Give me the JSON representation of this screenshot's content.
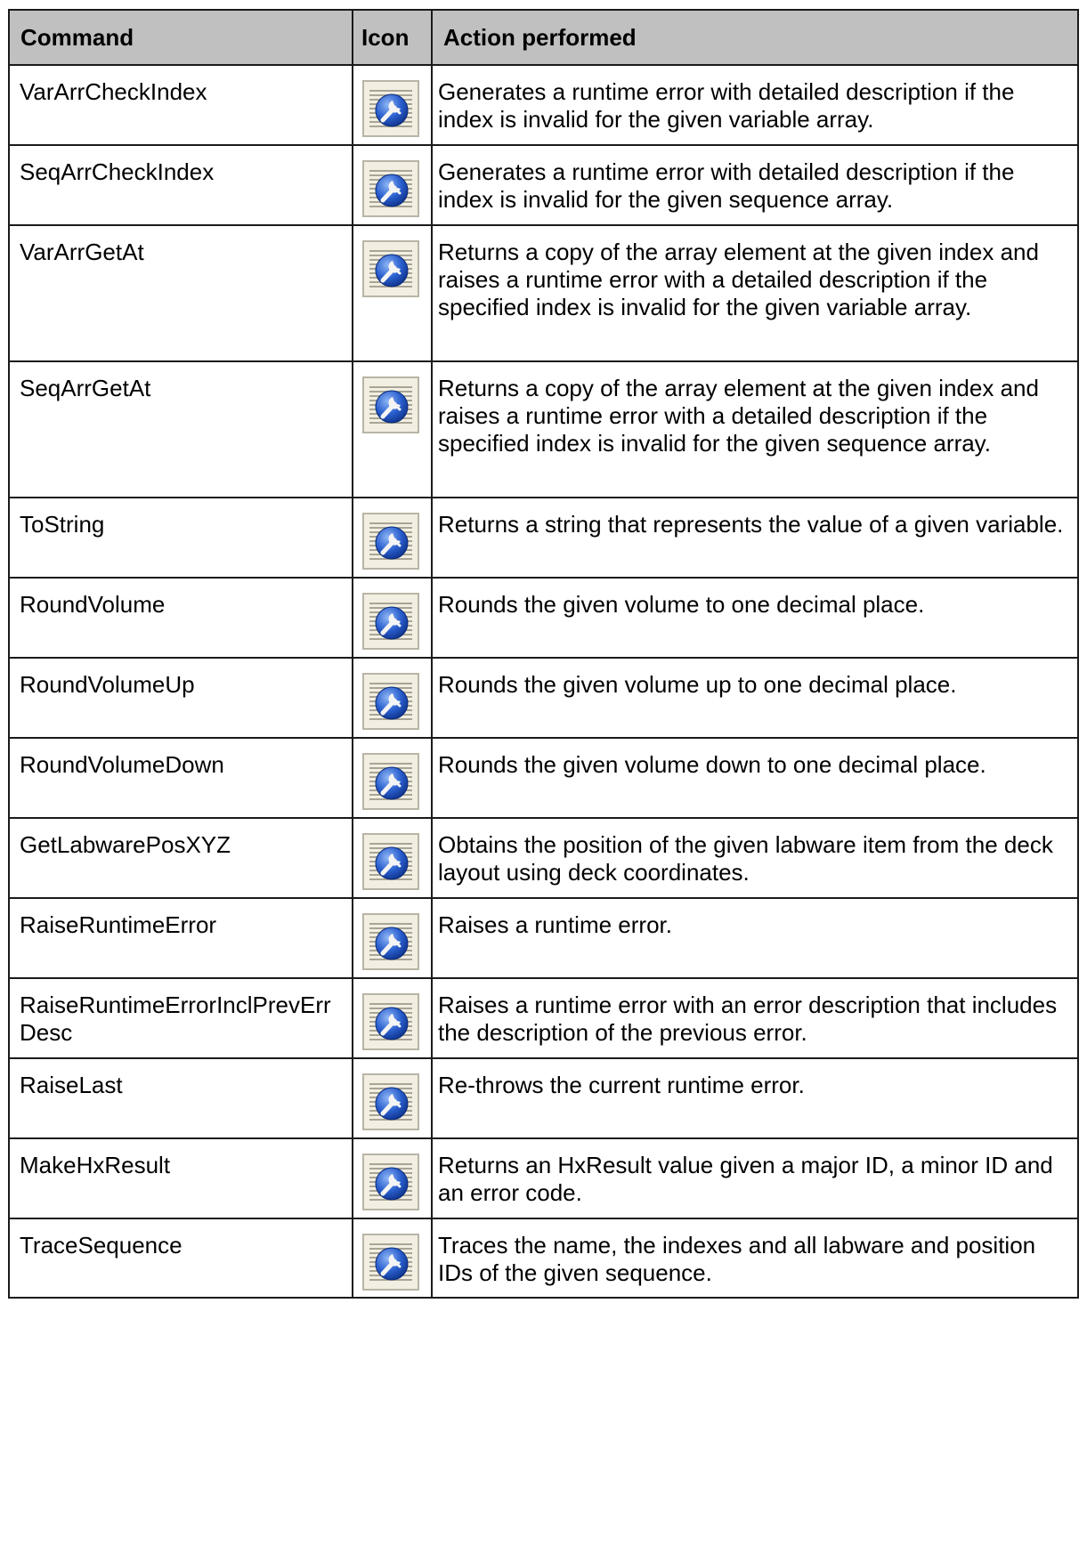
{
  "table": {
    "headers": {
      "command": "Command",
      "icon": "Icon",
      "action": "Action performed"
    },
    "rows": [
      {
        "command": "VarArrCheckIndex",
        "icon": "wrench-globe-icon",
        "action": "Generates a runtime error with detailed description if the index is invalid for the given variable array."
      },
      {
        "command": "SeqArrCheckIndex",
        "icon": "wrench-globe-icon",
        "action": "Generates a runtime error with detailed description if the index is invalid for the given sequence array."
      },
      {
        "command": "VarArrGetAt",
        "icon": "wrench-globe-icon",
        "action": "Returns a copy of the array element at the given index and raises a runtime error with a detailed description if the specified index is invalid for the given variable array."
      },
      {
        "command": "SeqArrGetAt",
        "icon": "wrench-globe-icon",
        "action": "Returns a copy of the array element at the given index and raises a runtime error with a detailed description if the specified index is invalid for the given sequence array."
      },
      {
        "command": "ToString",
        "icon": "wrench-globe-icon",
        "action": "Returns a string that represents the value of a given variable."
      },
      {
        "command": "RoundVolume",
        "icon": "wrench-globe-icon",
        "action": "Rounds the given volume to one decimal place."
      },
      {
        "command": "RoundVolumeUp",
        "icon": "wrench-globe-icon",
        "action": "Rounds the given volume up to one decimal place."
      },
      {
        "command": "RoundVolumeDown",
        "icon": "wrench-globe-icon",
        "action": "Rounds the given volume down to one decimal place."
      },
      {
        "command": "GetLabwarePosXYZ",
        "icon": "wrench-globe-icon",
        "action": "Obtains the position of the given labware item from the deck layout using deck coordinates."
      },
      {
        "command": "RaiseRuntimeError",
        "icon": "wrench-globe-icon",
        "action": "Raises a runtime error."
      },
      {
        "command": "RaiseRuntimeErrorInclPrevErrDesc",
        "icon": "wrench-globe-icon",
        "action": "Raises a runtime error with an error description that includes the description of the previous error."
      },
      {
        "command": "RaiseLast",
        "icon": "wrench-globe-icon",
        "action": "Re-throws the current runtime error."
      },
      {
        "command": "MakeHxResult",
        "icon": "wrench-globe-icon",
        "action": "Returns an HxResult value given a major ID, a minor ID and an error code."
      },
      {
        "command": "TraceSequence",
        "icon": "wrench-globe-icon",
        "action": "Traces the name, the indexes and all labware and position IDs of the given sequence."
      }
    ]
  }
}
